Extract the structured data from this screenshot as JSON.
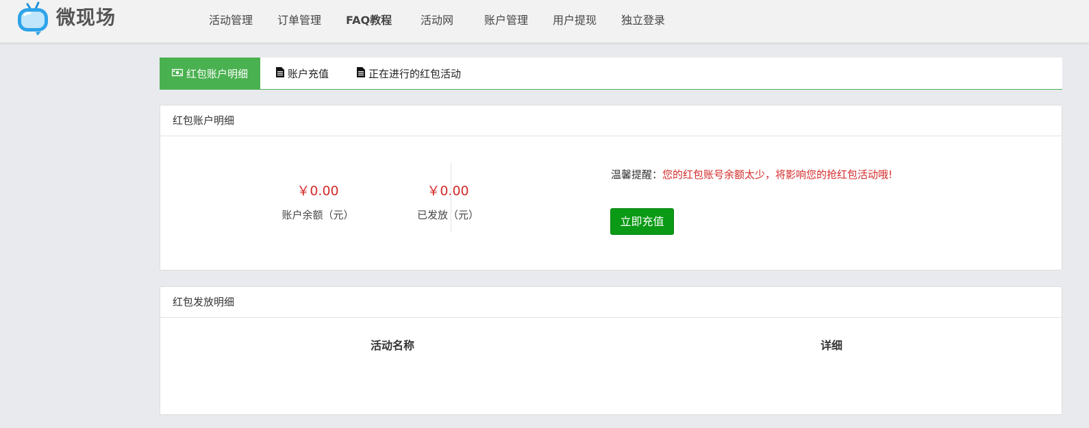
{
  "brand": {
    "name": "微现场"
  },
  "nav": [
    {
      "label": "活动管理",
      "bold": false
    },
    {
      "label": "订单管理",
      "bold": false
    },
    {
      "label": "FAQ教程",
      "bold": true
    },
    {
      "label": "活动网",
      "bold": false
    },
    {
      "label": "账户管理",
      "bold": false
    },
    {
      "label": "用户提现",
      "bold": false
    },
    {
      "label": "独立登录",
      "bold": false
    }
  ],
  "tabs": [
    {
      "label": "红包账户明细",
      "icon": "money-icon",
      "active": true
    },
    {
      "label": "账户充值",
      "icon": "document-icon",
      "active": false
    },
    {
      "label": "正在进行的红包活动",
      "icon": "document-icon",
      "active": false
    }
  ],
  "account_panel": {
    "title": "红包账户明细",
    "balance_value": "￥0.00",
    "balance_label": "账户余额（元）",
    "issued_value": "￥0.00",
    "issued_label": "已发放（元）",
    "tip_label": "温馨提醒：",
    "tip_text": "您的红包账号余额太少，将影响您的抢红包活动哦!",
    "recharge_button": "立即充值"
  },
  "issue_panel": {
    "title": "红包发放明细",
    "columns": [
      "活动名称",
      "详细"
    ]
  },
  "colors": {
    "accent_green": "#4ab150",
    "button_green": "#0a9a15",
    "alert_red": "#d42a2a",
    "background": "#e9eaee"
  }
}
